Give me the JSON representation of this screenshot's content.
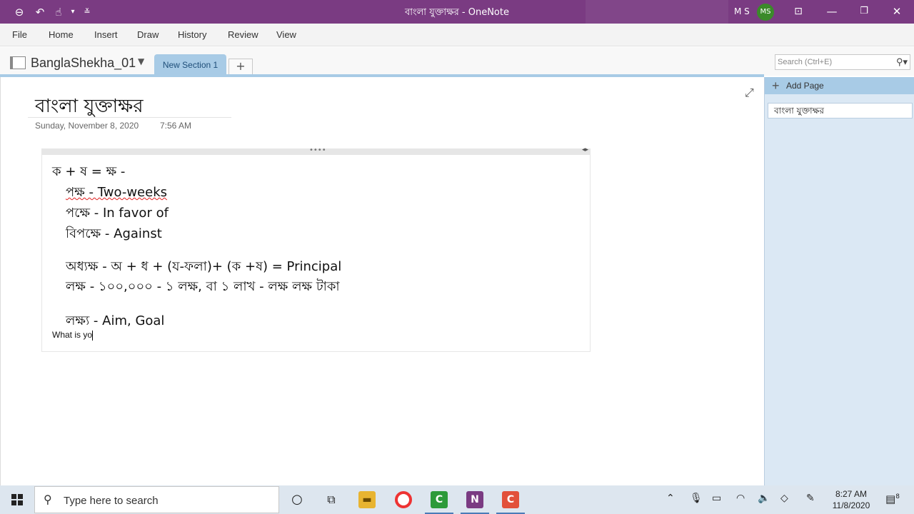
{
  "window": {
    "title": "বাংলা যুক্তাক্ষর  -  OneNote",
    "user_initials": "M S",
    "avatar": "MS"
  },
  "menu": [
    "File",
    "Home",
    "Insert",
    "Draw",
    "History",
    "Review",
    "View"
  ],
  "notebook": {
    "name": "BanglaShekha_01",
    "section_tab": "New Section 1",
    "add_tab": "+",
    "search_placeholder": "Search (Ctrl+E)"
  },
  "page": {
    "title": "বাংলা যুক্তাক্ষর",
    "date": "Sunday, November 8, 2020",
    "time": "7:56 AM",
    "lines": [
      "ক + ষ = ক্ষ -",
      "পক্ষ  - Two-weeks",
      "পক্ষে - In favor of",
      "বিপক্ষে - Against",
      "অধ্যক্ষ - অ + ধ + (য-ফলা)+ (ক +ষ) =  Principal",
      "লক্ষ - ১০০,০০০ - ১ লক্ষ, বা  ১ লাখ - লক্ষ লক্ষ টাকা",
      "লক্ষ্য - Aim, Goal",
      "What is yo"
    ]
  },
  "pages_panel": {
    "add_page": "Add Page",
    "items": [
      "বাংলা যুক্তাক্ষর"
    ]
  },
  "taskbar": {
    "search_text": "Type here to search",
    "time": "8:27 AM",
    "date": "11/8/2020",
    "notification_count": "8"
  },
  "colors": {
    "titlebar": "#7a3b82",
    "section_tab": "#a8cbe6",
    "pages_panel": "#dbe8f4",
    "taskbar": "#dde6ef"
  }
}
